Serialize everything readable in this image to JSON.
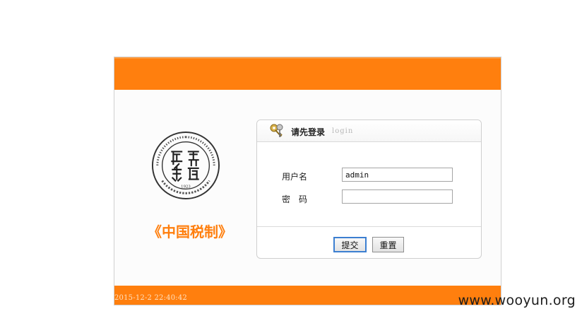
{
  "login": {
    "title": "请先登录",
    "subtitle": "login",
    "username_label": "用户名",
    "password_label": "密码",
    "username_value": "admin",
    "password_value": "",
    "submit_label": "提交",
    "reset_label": "重置"
  },
  "brand": {
    "text": "《中国税制》",
    "color": "#ff7f0e",
    "seal_name": "Jiangxi University of Finance and Economics",
    "seal_year": "1923"
  },
  "footer": {
    "timestamp": "2015-12-2 22:40:42"
  },
  "watermark": "www.wooyun.org",
  "colors": {
    "accent": "#ff7f0e",
    "focus": "#3c7fd1"
  }
}
